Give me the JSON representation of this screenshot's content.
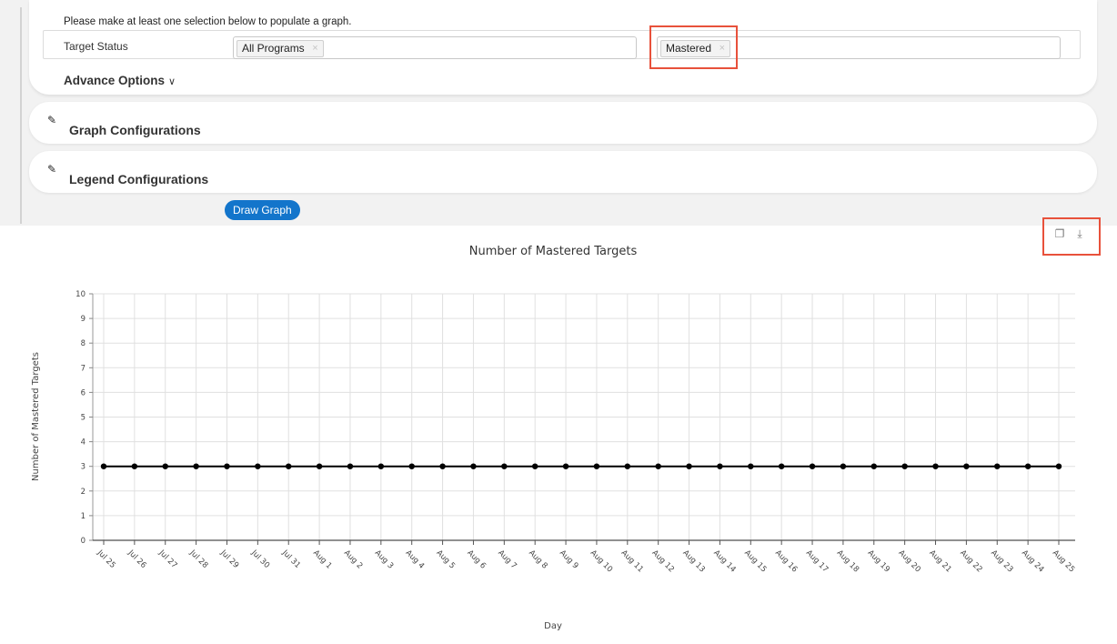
{
  "filters": {
    "instruction": "Please make at least one selection below to populate a graph.",
    "target_status_label": "Target Status",
    "program_select": {
      "selected": "All Programs"
    },
    "status_select": {
      "selected": "Mastered"
    },
    "remove_symbol": "×",
    "advance_options_label": "Advance Options",
    "advance_options_chevron": "∨"
  },
  "sections": {
    "graph_config_label": "Graph Configurations",
    "legend_config_label": "Legend Configurations",
    "edit_symbol": "✎"
  },
  "actions": {
    "draw_graph_label": "Draw Graph",
    "copy_symbol": "❐",
    "download_symbol": "⤓"
  },
  "colors": {
    "accent": "#1375cb",
    "highlight": "#e8513b",
    "series": "#000000",
    "grid": "#e0e0e0"
  },
  "chart_data": {
    "type": "line",
    "title": "Number of Mastered Targets",
    "xlabel": "Day",
    "ylabel": "Number of Mastered Targets",
    "ylim": [
      0,
      10
    ],
    "yticks": [
      0,
      1,
      2,
      3,
      4,
      5,
      6,
      7,
      8,
      9,
      10
    ],
    "grid": true,
    "categories": [
      "Jul 25",
      "Jul 26",
      "Jul 27",
      "Jul 28",
      "Jul 29",
      "Jul 30",
      "Jul 31",
      "Aug 1",
      "Aug 2",
      "Aug 3",
      "Aug 4",
      "Aug 5",
      "Aug 6",
      "Aug 7",
      "Aug 8",
      "Aug 9",
      "Aug 10",
      "Aug 11",
      "Aug 12",
      "Aug 13",
      "Aug 14",
      "Aug 15",
      "Aug 16",
      "Aug 17",
      "Aug 18",
      "Aug 19",
      "Aug 20",
      "Aug 21",
      "Aug 22",
      "Aug 23",
      "Aug 24",
      "Aug 25"
    ],
    "series": [
      {
        "values": [
          3,
          3,
          3,
          3,
          3,
          3,
          3,
          3,
          3,
          3,
          3,
          3,
          3,
          3,
          3,
          3,
          3,
          3,
          3,
          3,
          3,
          3,
          3,
          3,
          3,
          3,
          3,
          3,
          3,
          3,
          3,
          3
        ]
      }
    ]
  }
}
